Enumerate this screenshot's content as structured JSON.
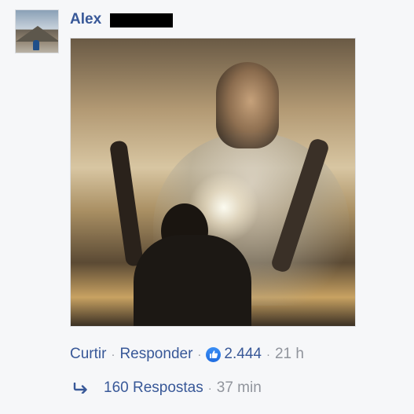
{
  "comment": {
    "author_name": "Alex",
    "actions": {
      "like_label": "Curtir",
      "reply_label": "Responder",
      "reaction_count": "2.444",
      "timestamp": "21 h"
    },
    "replies": {
      "label": "160 Respostas",
      "timestamp": "37 min"
    }
  },
  "icons": {
    "avatar": "profile-photo",
    "reaction": "like-thumbs-up-icon",
    "reply": "reply-arrow-icon"
  },
  "colors": {
    "link": "#385898",
    "muted": "#90949c",
    "like_badge": "#1f6ce0",
    "background": "#f6f7f9"
  }
}
